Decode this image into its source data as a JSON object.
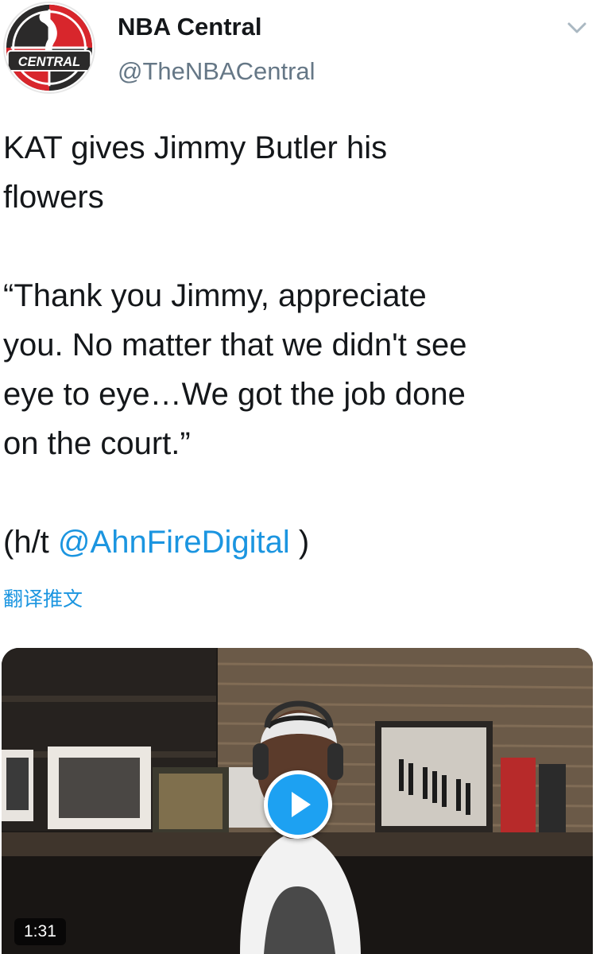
{
  "tweet": {
    "author": {
      "name": "NBA Central",
      "handle": "@TheNBACentral",
      "logo_text": "CENTRAL"
    },
    "text": {
      "line1": "KAT gives Jimmy Butler his\nflowers\n\n“Thank you Jimmy, appreciate\nyou. No matter that we didn't see\neye to eye…We got the job done\non the court.”\n\n(h/t ",
      "mention": "@AhnFireDigital",
      "tail": " )"
    },
    "translate_label": "翻译推文"
  },
  "media": {
    "duration": "1:31"
  },
  "colors": {
    "link": "#1b95e0",
    "play_button": "#1da1f2",
    "logo_red": "#d8262c",
    "logo_dark": "#2b2a2a"
  },
  "icons": {
    "caret": "chevron-down-icon",
    "play": "play-icon"
  }
}
